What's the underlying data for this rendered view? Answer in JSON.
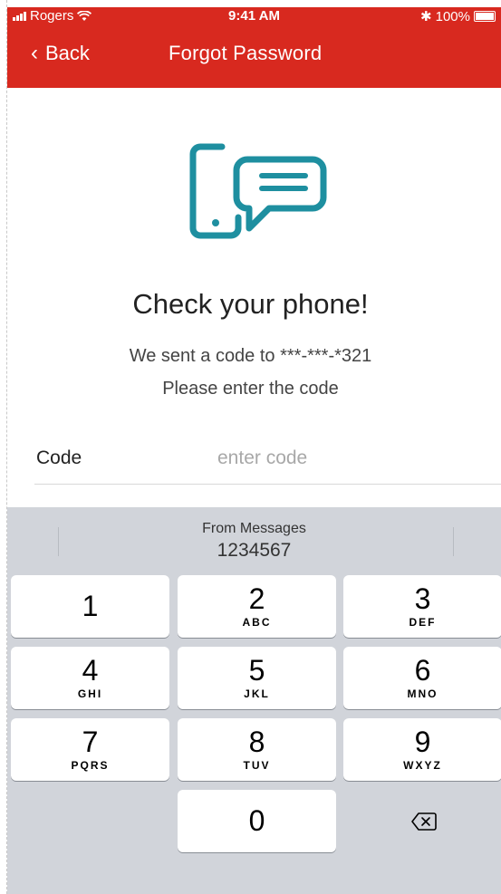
{
  "status_bar": {
    "carrier": "Rogers",
    "time": "9:41 AM",
    "battery": "100%"
  },
  "nav": {
    "back_label": "Back",
    "title": "Forgot Password"
  },
  "content": {
    "icon": "phone-message-icon",
    "headline": "Check your phone!",
    "sent_line": "We sent a code to ***-***-*321",
    "instruction": "Please enter the code"
  },
  "form": {
    "code_label": "Code",
    "code_placeholder": "enter code",
    "code_value": ""
  },
  "keyboard": {
    "suggestion_source": "From Messages",
    "suggestion_value": "1234567",
    "keys": [
      {
        "num": "1",
        "letters": ""
      },
      {
        "num": "2",
        "letters": "ABC"
      },
      {
        "num": "3",
        "letters": "DEF"
      },
      {
        "num": "4",
        "letters": "GHI"
      },
      {
        "num": "5",
        "letters": "JKL"
      },
      {
        "num": "6",
        "letters": "MNO"
      },
      {
        "num": "7",
        "letters": "PQRS"
      },
      {
        "num": "8",
        "letters": "TUV"
      },
      {
        "num": "9",
        "letters": "WXYZ"
      },
      {
        "num": "0",
        "letters": ""
      }
    ],
    "delete_icon": "backspace-icon"
  },
  "colors": {
    "header": "#d8291f",
    "icon": "#1e8fa0",
    "keyboard_bg": "#d1d4da"
  }
}
